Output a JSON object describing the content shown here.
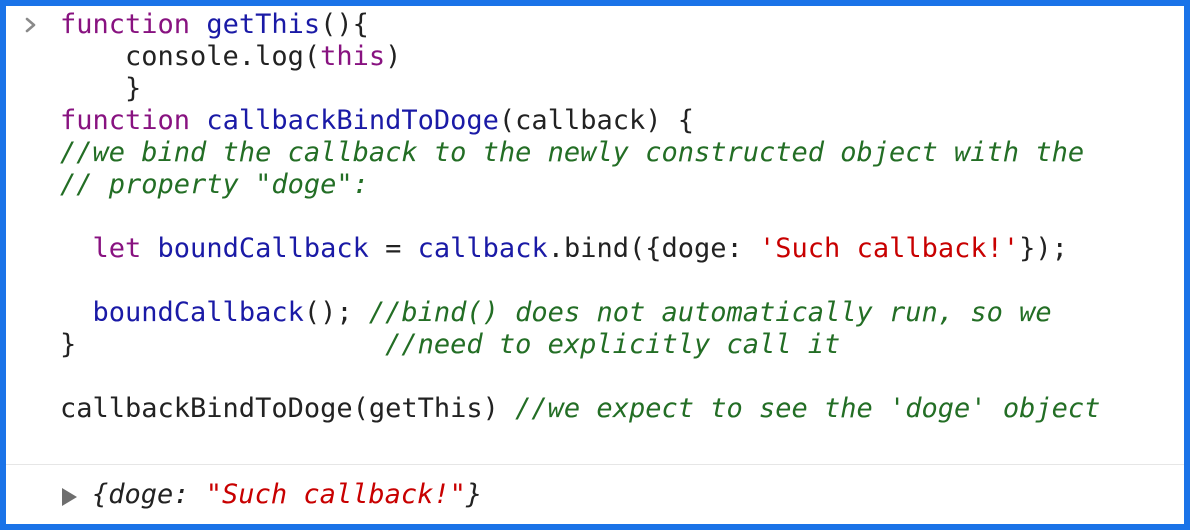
{
  "console": {
    "prompt_icon": "chevron-right-icon",
    "code_lines": [
      [
        {
          "t": "kw",
          "v": "function "
        },
        {
          "t": "fn",
          "v": "getThis"
        },
        {
          "t": "plain",
          "v": "(){"
        }
      ],
      [
        {
          "t": "plain",
          "v": "    console.log("
        },
        {
          "t": "kw",
          "v": "this"
        },
        {
          "t": "plain",
          "v": ")"
        }
      ],
      [
        {
          "t": "plain",
          "v": "    }"
        }
      ],
      [
        {
          "t": "kw",
          "v": "function "
        },
        {
          "t": "fn",
          "v": "callbackBindToDoge"
        },
        {
          "t": "plain",
          "v": "(callback) {"
        }
      ],
      [
        {
          "t": "cmt",
          "v": "//we bind the callback to the newly constructed object with the"
        }
      ],
      [
        {
          "t": "cmt",
          "v": "// property \"doge\":"
        }
      ],
      [
        {
          "t": "plain",
          "v": ""
        }
      ],
      [
        {
          "t": "plain",
          "v": "  "
        },
        {
          "t": "kw",
          "v": "let "
        },
        {
          "t": "fn",
          "v": "boundCallback"
        },
        {
          "t": "plain",
          "v": " = "
        },
        {
          "t": "fn",
          "v": "callback"
        },
        {
          "t": "plain",
          "v": ".bind({doge: "
        },
        {
          "t": "str",
          "v": "'Such callback!'"
        },
        {
          "t": "plain",
          "v": "});"
        }
      ],
      [
        {
          "t": "plain",
          "v": ""
        }
      ],
      [
        {
          "t": "plain",
          "v": "  "
        },
        {
          "t": "fn",
          "v": "boundCallback"
        },
        {
          "t": "plain",
          "v": "(); "
        },
        {
          "t": "cmt",
          "v": "//bind() does not automatically run, so we"
        }
      ],
      [
        {
          "t": "plain",
          "v": "}                   "
        },
        {
          "t": "cmt",
          "v": "//need to explicitly call it"
        }
      ],
      [
        {
          "t": "plain",
          "v": ""
        }
      ],
      [
        {
          "t": "plain",
          "v": "callbackBindToDoge(getThis) "
        },
        {
          "t": "cmt",
          "v": "//we expect to see the 'doge' object"
        }
      ]
    ]
  },
  "result": {
    "expand_icon": "triangle-right-icon",
    "open": "{doge: ",
    "value": "\"Such callback!\"",
    "close": "}"
  },
  "colors": {
    "frame_border": "#1a73e8",
    "keyword": "#881280",
    "identifier": "#1a1aa6",
    "string": "#c80000",
    "comment": "#236e25"
  }
}
